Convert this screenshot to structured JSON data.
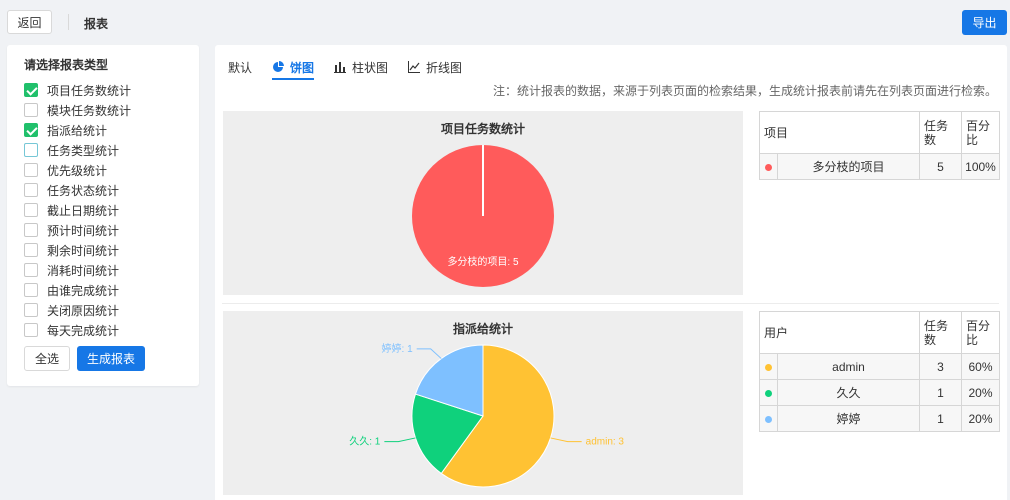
{
  "header": {
    "back_label": "返回",
    "title": "报表",
    "export_label": "导出"
  },
  "sidebar": {
    "title": "请选择报表类型",
    "items": [
      {
        "label": "项目任务数统计",
        "checked": true
      },
      {
        "label": "模块任务数统计",
        "checked": false
      },
      {
        "label": "指派给统计",
        "checked": true
      },
      {
        "label": "任务类型统计",
        "checked": false
      },
      {
        "label": "优先级统计",
        "checked": false
      },
      {
        "label": "任务状态统计",
        "checked": false
      },
      {
        "label": "截止日期统计",
        "checked": false
      },
      {
        "label": "预计时间统计",
        "checked": false
      },
      {
        "label": "剩余时间统计",
        "checked": false
      },
      {
        "label": "消耗时间统计",
        "checked": false
      },
      {
        "label": "由谁完成统计",
        "checked": false
      },
      {
        "label": "关闭原因统计",
        "checked": false
      },
      {
        "label": "每天完成统计",
        "checked": false
      }
    ],
    "select_all_label": "全选",
    "generate_label": "生成报表"
  },
  "tabs": [
    {
      "label": "默认",
      "icon": "none",
      "active": false
    },
    {
      "label": "饼图",
      "icon": "pie-chart-icon",
      "active": true
    },
    {
      "label": "柱状图",
      "icon": "bar-chart-icon",
      "active": false
    },
    {
      "label": "折线图",
      "icon": "line-chart-icon",
      "active": false
    }
  ],
  "note": "注：统计报表的数据，来源于列表页面的检索结果，生成统计报表前请先在列表页面进行检索。",
  "colors": {
    "primary": "#1677e6",
    "checked": "#20c06b",
    "red": "#ff5b5b",
    "yellow": "#ffc233",
    "green": "#0fd17c",
    "blue": "#7ec0ff"
  },
  "reports": [
    {
      "table": {
        "headers": [
          "项目",
          "任务数",
          "百分比"
        ],
        "rows": [
          {
            "name": "多分枝的项目",
            "count": "5",
            "percent": "100%",
            "color": "#ff5b5b"
          }
        ]
      }
    },
    {
      "table": {
        "headers": [
          "用户",
          "任务数",
          "百分比"
        ],
        "rows": [
          {
            "name": "admin",
            "count": "3",
            "percent": "60%",
            "color": "#ffc233"
          },
          {
            "name": "久久",
            "count": "1",
            "percent": "20%",
            "color": "#0fd17c"
          },
          {
            "name": "婷婷",
            "count": "1",
            "percent": "20%",
            "color": "#7ec0ff"
          }
        ]
      }
    }
  ],
  "chart_data": [
    {
      "type": "pie",
      "title": "项目任务数统计",
      "categories": [
        "多分枝的项目"
      ],
      "values": [
        5
      ],
      "slice_labels": [
        "多分枝的项目: 5"
      ],
      "colors": [
        "#ff5b5b"
      ]
    },
    {
      "type": "pie",
      "title": "指派给统计",
      "categories": [
        "admin",
        "久久",
        "婷婷"
      ],
      "values": [
        3,
        1,
        1
      ],
      "slice_labels": [
        "admin: 3",
        "久久: 1",
        "婷婷: 1"
      ],
      "colors": [
        "#ffc233",
        "#0fd17c",
        "#7ec0ff"
      ]
    }
  ]
}
